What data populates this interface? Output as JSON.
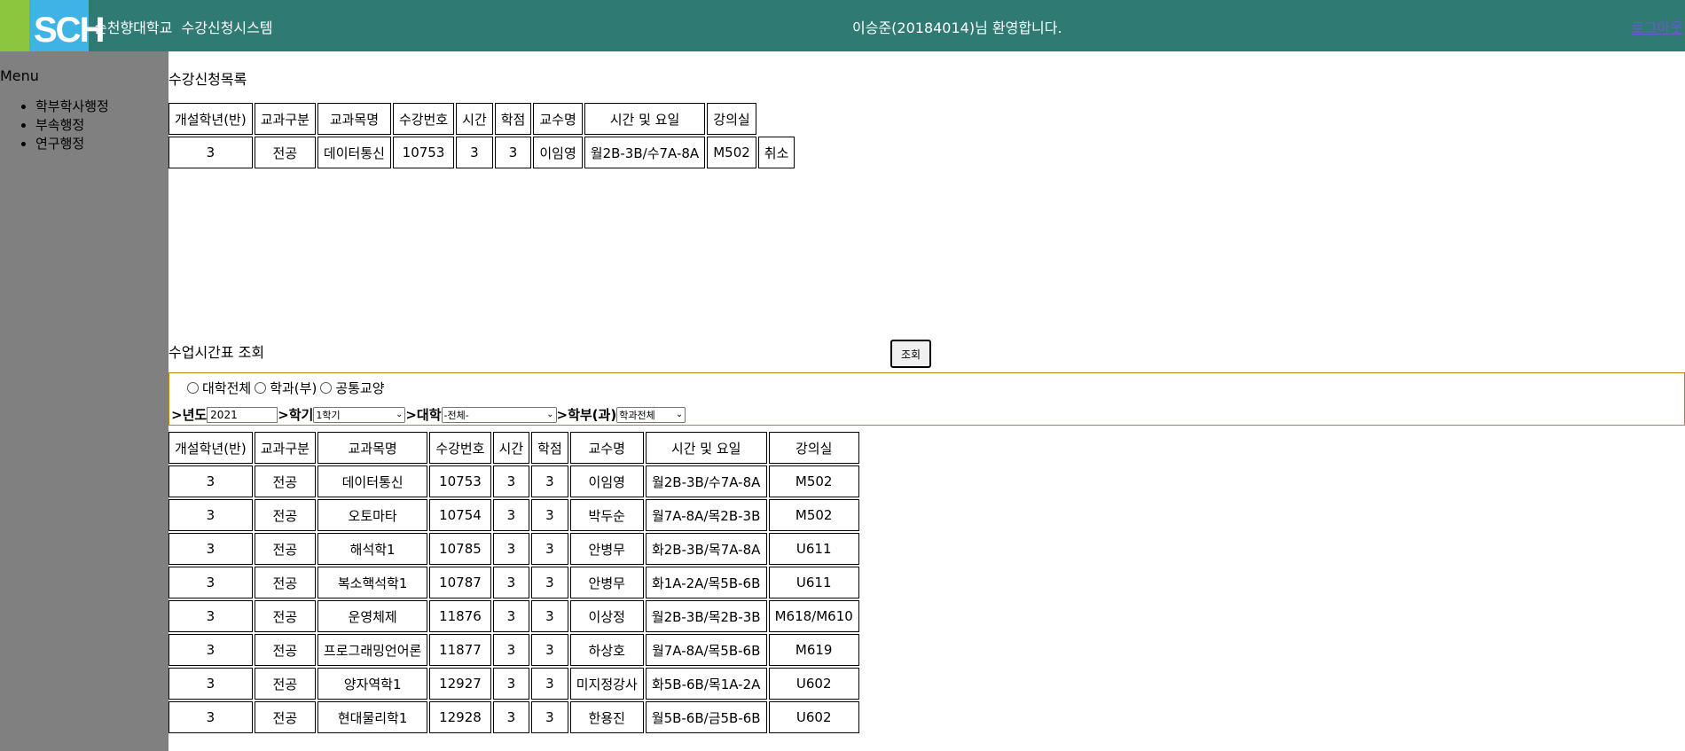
{
  "header": {
    "logo_text": "SCH",
    "app_title": "순천향대학교  수강신청시스템",
    "welcome": "이승준(20184014)님 환영합니다.",
    "logout": "로그아웃",
    "bg_color": "#2f7a73"
  },
  "sidebar": {
    "title": "Menu",
    "items": [
      {
        "label": "학부학사행정"
      },
      {
        "label": "부속행정"
      },
      {
        "label": "연구행정"
      }
    ]
  },
  "registered": {
    "title": "수강신청목록",
    "headers": [
      "개설학년(반)",
      "교과구분",
      "교과목명",
      "수강번호",
      "시간",
      "학점",
      "교수명",
      "시간 및 요일",
      "강의실"
    ],
    "rows": [
      [
        "3",
        "전공",
        "데이터통신",
        "10753",
        "3",
        "3",
        "이임영",
        "월2B-3B/수7A-8A",
        "M502"
      ]
    ],
    "cancel_label": "취소"
  },
  "timetable": {
    "title": "수업시간표 조회",
    "search_button": "조회",
    "radio_options": [
      "대학전체",
      "학과(부)",
      "공통교양"
    ],
    "filters": {
      "year_label": ">년도",
      "year_value": "2021",
      "semester_label": ">학기",
      "semester_value": "1학기",
      "college_label": ">대학",
      "college_value": "-전체-",
      "dept_label": ">학부(과)",
      "dept_value": "학과전체"
    },
    "headers": [
      "개설학년(반)",
      "교과구분",
      "교과목명",
      "수강번호",
      "시간",
      "학점",
      "교수명",
      "시간 및 요일",
      "강의실"
    ],
    "rows": [
      [
        "3",
        "전공",
        "데이터통신",
        "10753",
        "3",
        "3",
        "이임영",
        "월2B-3B/수7A-8A",
        "M502"
      ],
      [
        "3",
        "전공",
        "오토마타",
        "10754",
        "3",
        "3",
        "박두순",
        "월7A-8A/목2B-3B",
        "M502"
      ],
      [
        "3",
        "전공",
        "해석학1",
        "10785",
        "3",
        "3",
        "안병무",
        "화2B-3B/목7A-8A",
        "U611"
      ],
      [
        "3",
        "전공",
        "복소핵석학1",
        "10787",
        "3",
        "3",
        "안병무",
        "화1A-2A/목5B-6B",
        "U611"
      ],
      [
        "3",
        "전공",
        "운영체제",
        "11876",
        "3",
        "3",
        "이상정",
        "월2B-3B/목2B-3B",
        "M618/M610"
      ],
      [
        "3",
        "전공",
        "프로그래밍언어론",
        "11877",
        "3",
        "3",
        "하상호",
        "월7A-8A/목5B-6B",
        "M619"
      ],
      [
        "3",
        "전공",
        "양자역학1",
        "12927",
        "3",
        "3",
        "미지정강사",
        "화5B-6B/목1A-2A",
        "U602"
      ],
      [
        "3",
        "전공",
        "현대물리학1",
        "12928",
        "3",
        "3",
        "한용진",
        "월5B-6B/금5B-6B",
        "U602"
      ]
    ]
  }
}
